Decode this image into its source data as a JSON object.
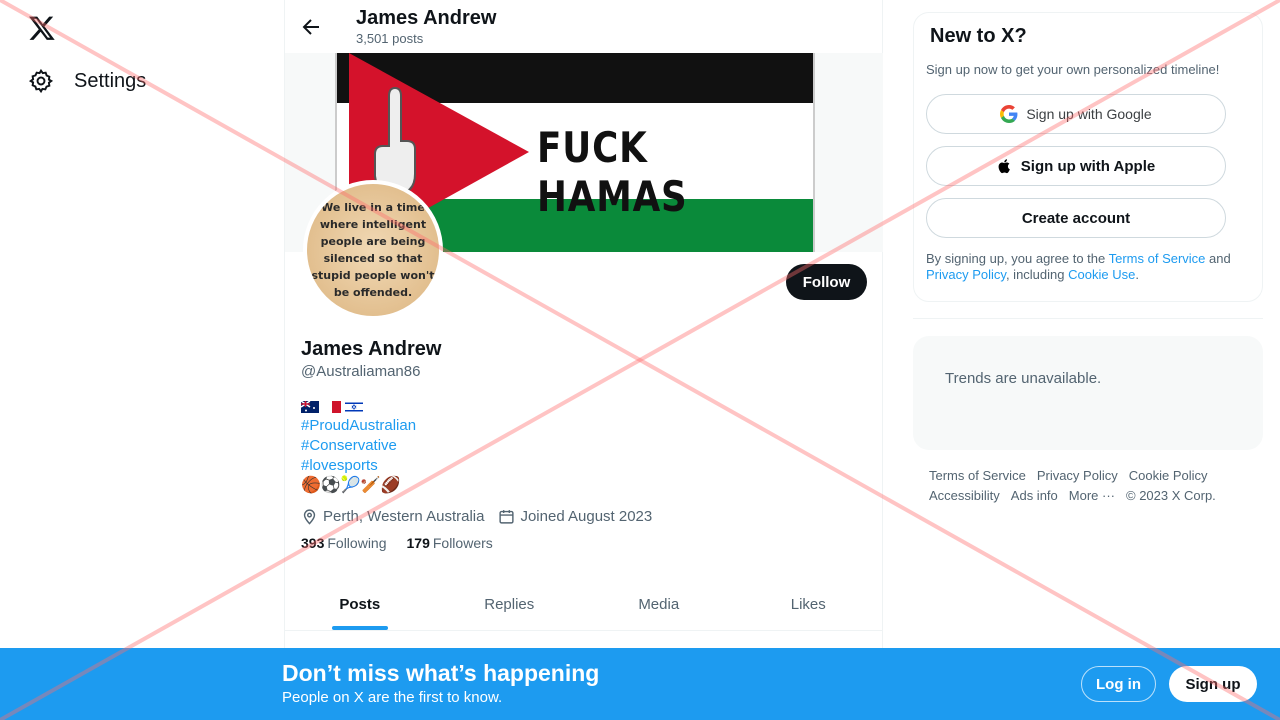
{
  "nav": {
    "logo_icon": "x-logo-icon",
    "settings_label": "Settings",
    "settings_icon": "gear-icon"
  },
  "header": {
    "title": "James Andrew",
    "posts_count": "3,501 posts",
    "back_icon": "back-arrow-icon"
  },
  "banner": {
    "text": "FUCK HAMAS"
  },
  "avatar": {
    "quote": "We live in a time where intelligent people are being silenced so that stupid people won't be offended."
  },
  "profile": {
    "follow_label": "Follow",
    "name": "James Andrew",
    "handle": "@Australiaman86",
    "hashtags": [
      "#ProudAustralian",
      "#Conservative",
      "#lovesports"
    ],
    "emojis": "🏀⚽🎾🏏🏈",
    "location": "Perth, Western Australia",
    "joined": "Joined August 2023",
    "following_count": "393",
    "following_label": "Following",
    "followers_count": "179",
    "followers_label": "Followers"
  },
  "tabs": [
    "Posts",
    "Replies",
    "Media",
    "Likes"
  ],
  "signup_card": {
    "title": "New to X?",
    "subtitle": "Sign up now to get your own personalized timeline!",
    "google": "Sign up with Google",
    "apple": "Sign up with Apple",
    "create": "Create account",
    "terms_prefix": "By signing up, you agree to the ",
    "terms_link": "Terms of Service",
    "terms_and": " and ",
    "privacy_link": "Privacy Policy",
    "terms_including": ", including ",
    "cookie_link": "Cookie Use",
    "terms_end": "."
  },
  "trends": {
    "text": "Trends are unavailable."
  },
  "footer": {
    "links": [
      "Terms of Service",
      "Privacy Policy",
      "Cookie Policy",
      "Accessibility",
      "Ads info",
      "More ···"
    ],
    "copyright": "© 2023 X Corp."
  },
  "bottom_bar": {
    "title": "Don’t miss what’s happening",
    "subtitle": "People on X are the first to know.",
    "login": "Log in",
    "signup": "Sign up"
  },
  "colors": {
    "accent": "#1d9bf0",
    "overlay_cross": "#ff6b6b"
  }
}
